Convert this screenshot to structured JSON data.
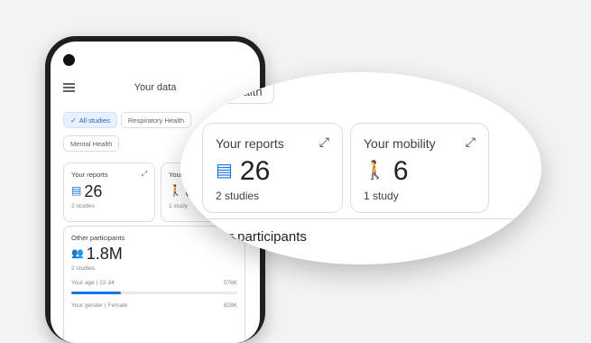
{
  "header": {
    "title": "Your data",
    "menu_icon": "menu-icon"
  },
  "chips": [
    {
      "label": "All studies",
      "selected": true,
      "icon": "check-icon"
    },
    {
      "label": "Respiratory Health",
      "selected": false
    },
    {
      "label": "Mental Health",
      "selected": false
    }
  ],
  "reports": {
    "title": "Your reports",
    "value": "26",
    "subtitle": "2 studies",
    "icon": "clipboard-icon"
  },
  "mobility": {
    "title": "Your mobility",
    "title_visible": "Your mobili",
    "value": "6",
    "subtitle": "1 study",
    "icon": "walking-icon"
  },
  "other_participants": {
    "title": "Other participants",
    "value": "1.8M",
    "subtitle": "2 studies",
    "icon": "people-icon",
    "stats": [
      {
        "label": "Your age  |  22-34",
        "value": "576K",
        "fill_fraction": 0.3
      },
      {
        "label": "Your gender  |  Female",
        "value": "828K"
      }
    ]
  },
  "magnifier": {
    "chip_label": "Health",
    "other_title_visible": "r participants"
  },
  "colors": {
    "accent": "#1a73e8",
    "chip_selected_bg": "#e8f0fe",
    "background": "#f1f3f4"
  }
}
